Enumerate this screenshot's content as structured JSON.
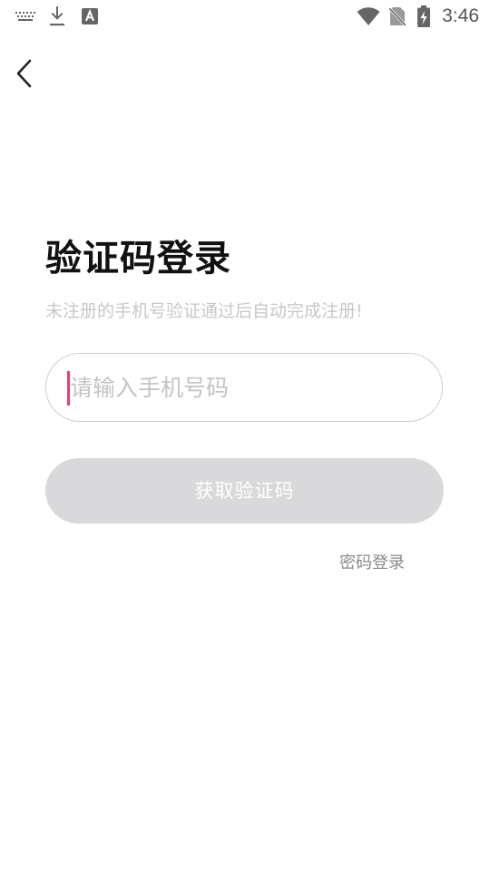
{
  "status_bar": {
    "time": "3:46",
    "left_icons": [
      "keyboard-icon",
      "download-icon",
      "text-a-icon"
    ],
    "right_icons": [
      "wifi-icon",
      "no-sim-icon",
      "battery-charging-icon"
    ]
  },
  "header": {
    "back_icon": "chevron-left-icon"
  },
  "main": {
    "title": "验证码登录",
    "subtitle": "未注册的手机号验证通过后自动完成注册!",
    "phone_input": {
      "placeholder": "请输入手机号码",
      "value": ""
    },
    "get_code_button": "获取验证码",
    "password_login_link": "密码登录"
  },
  "colors": {
    "caret": "#e0407a",
    "button_disabled_bg": "#d9d9db",
    "subtitle_text": "#c8c8c8",
    "link_text": "#8a8a8a"
  }
}
